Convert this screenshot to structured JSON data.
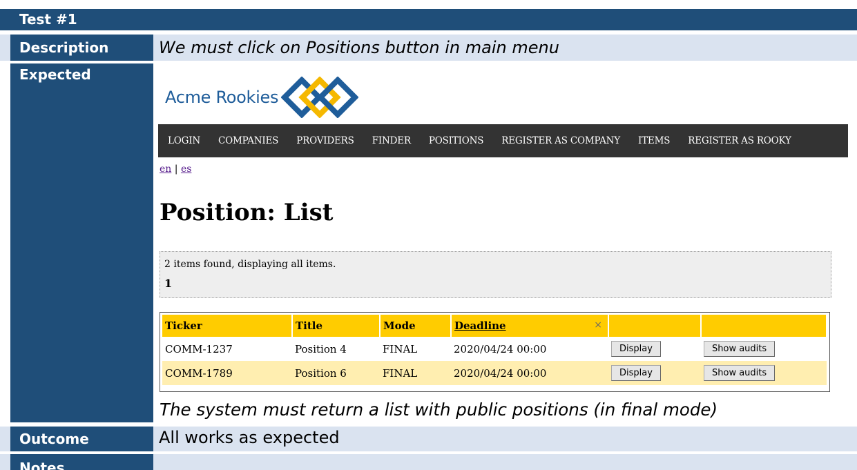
{
  "test": {
    "label": "Test #1"
  },
  "description": {
    "label": "Description",
    "value": "We must click on Positions button in main menu"
  },
  "expected": {
    "label": "Expected",
    "caption": "The system must return a list with public positions (in final mode)"
  },
  "outcome": {
    "label": "Outcome",
    "value": "All works as expected"
  },
  "notes": {
    "label": "Notes"
  },
  "colors": {
    "label_bg": "#1f4e79",
    "row_bg": "#dae3f0",
    "nav_bg": "#333333",
    "table_header": "#ffcc00",
    "alt_row": "#ffeeb0"
  },
  "webpage": {
    "brand": "Acme Rookies",
    "logo_icon": "diamond-chain-logo",
    "nav": [
      "LOGIN",
      "COMPANIES",
      "PROVIDERS",
      "FINDER",
      "POSITIONS",
      "REGISTER AS COMPANY",
      "ITEMS",
      "REGISTER AS ROOKY"
    ],
    "lang_en": "en",
    "lang_sep": " | ",
    "lang_es": "es",
    "heading": "Position: List",
    "found_text": "2 items found, displaying all items.",
    "page_number": "1",
    "table": {
      "headers": [
        "Ticker",
        "Title",
        "Mode",
        "Deadline",
        "",
        ""
      ],
      "sort_clear": "×",
      "rows": [
        {
          "ticker": "COMM-1237",
          "title": "Position 4",
          "mode": "FINAL",
          "deadline": "2020/04/24 00:00",
          "display": "Display",
          "audits": "Show audits"
        },
        {
          "ticker": "COMM-1789",
          "title": "Position 6",
          "mode": "FINAL",
          "deadline": "2020/04/24 00:00",
          "display": "Display",
          "audits": "Show audits"
        }
      ]
    }
  }
}
